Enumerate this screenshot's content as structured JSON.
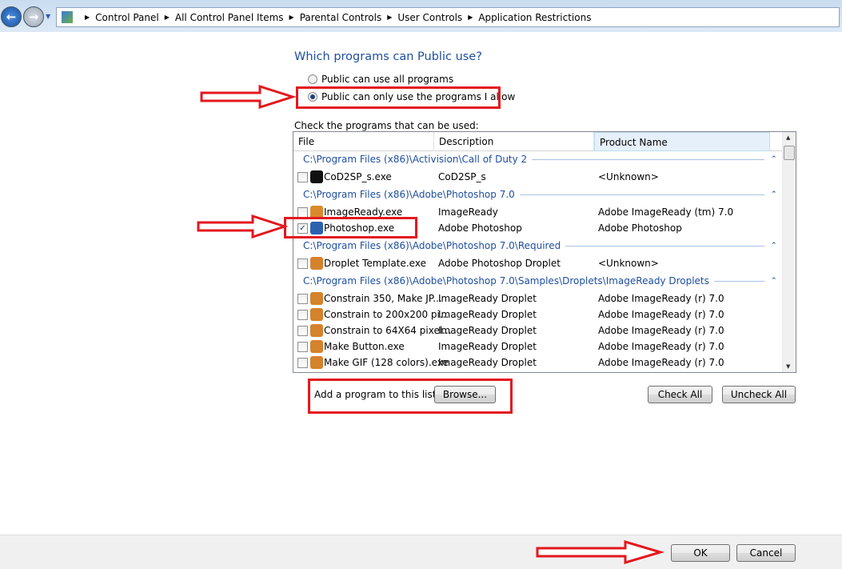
{
  "breadcrumb": [
    "Control Panel",
    "All Control Panel Items",
    "Parental Controls",
    "User Controls",
    "Application Restrictions"
  ],
  "heading": "Which programs can Public use?",
  "radios": [
    {
      "label": "Public can use all programs",
      "selected": false
    },
    {
      "label": "Public can only use the programs I allow",
      "selected": true
    }
  ],
  "list_label": "Check the programs that can be used:",
  "columns": [
    "File",
    "Description",
    "Product Name"
  ],
  "groups": [
    {
      "path": "C:\\Program Files (x86)\\Activision\\Call of Duty 2",
      "items": [
        {
          "file": "CoD2SP_s.exe",
          "desc": "CoD2SP_s",
          "product": "<Unknown>",
          "checked": false
        }
      ]
    },
    {
      "path": "C:\\Program Files (x86)\\Adobe\\Photoshop 7.0",
      "items": [
        {
          "file": "ImageReady.exe",
          "desc": "ImageReady",
          "product": "Adobe ImageReady (tm) 7.0",
          "checked": false
        },
        {
          "file": "Photoshop.exe",
          "desc": "Adobe Photoshop",
          "product": "Adobe Photoshop",
          "checked": true
        }
      ]
    },
    {
      "path": "C:\\Program Files (x86)\\Adobe\\Photoshop 7.0\\Required",
      "items": [
        {
          "file": "Droplet Template.exe",
          "desc": "Adobe Photoshop Droplet",
          "product": "<Unknown>",
          "checked": false
        }
      ]
    },
    {
      "path": "C:\\Program Files (x86)\\Adobe\\Photoshop 7.0\\Samples\\Droplets\\ImageReady Droplets",
      "items": [
        {
          "file": "Constrain 350, Make JP...",
          "desc": "ImageReady Droplet",
          "product": "Adobe ImageReady (r) 7.0",
          "checked": false
        },
        {
          "file": "Constrain to 200x200 pi...",
          "desc": "ImageReady Droplet",
          "product": "Adobe ImageReady (r) 7.0",
          "checked": false
        },
        {
          "file": "Constrain to 64X64 pixel...",
          "desc": "ImageReady Droplet",
          "product": "Adobe ImageReady (r) 7.0",
          "checked": false
        },
        {
          "file": "Make Button.exe",
          "desc": "ImageReady Droplet",
          "product": "Adobe ImageReady (r) 7.0",
          "checked": false
        },
        {
          "file": "Make GIF (128 colors).exe",
          "desc": "ImageReady Droplet",
          "product": "Adobe ImageReady (r) 7.0",
          "checked": false
        }
      ]
    }
  ],
  "add_label": "Add a program to this list:",
  "browse": "Browse...",
  "check_all": "Check All",
  "uncheck_all": "Uncheck All",
  "ok": "OK",
  "cancel": "Cancel",
  "annotation_color": "#e3181e"
}
